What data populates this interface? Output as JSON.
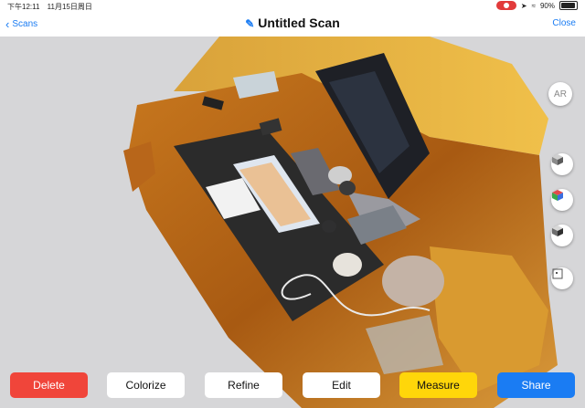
{
  "status_bar": {
    "time": "下午12:11",
    "date": "11月15日周日",
    "battery": "90%"
  },
  "nav": {
    "back_label": "Scans",
    "title": "Untitled Scan",
    "close_label": "Close"
  },
  "side_controls": {
    "ar_label": "AR",
    "icons": [
      "solid-cube-icon",
      "colorized-cube-icon",
      "textured-cube-icon",
      "bounding-box-icon"
    ]
  },
  "toolbar": {
    "delete_label": "Delete",
    "colorize_label": "Colorize",
    "refine_label": "Refine",
    "edit_label": "Edit",
    "measure_label": "Measure",
    "share_label": "Share"
  },
  "colors": {
    "accent": "#1a7cf3",
    "delete": "#f0453a",
    "measure": "#ffd60a",
    "share": "#1a7cf3",
    "recording": "#e23b3b"
  }
}
